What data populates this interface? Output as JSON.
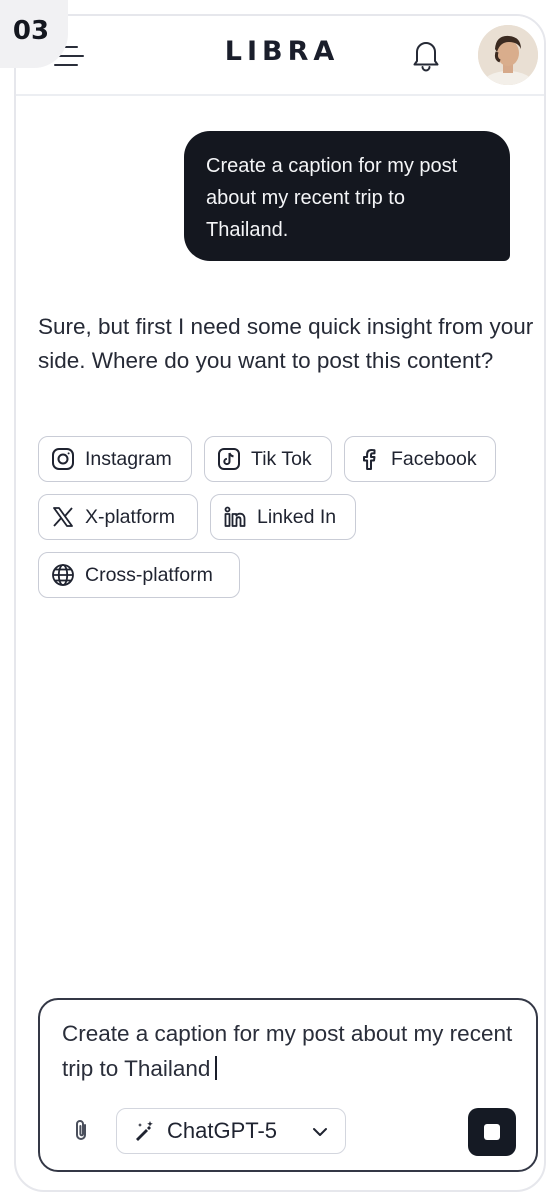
{
  "step_badge": "03",
  "header": {
    "brand": "LIBRA",
    "menu_icon": "hamburger-menu-icon",
    "notification_icon": "bell-icon",
    "avatar": "user-avatar"
  },
  "chat": {
    "user_message": "Create a caption for my post about my recent trip to Thailand.",
    "assistant_message": "Sure, but first I need some quick insight from your side. Where do you want to post this content?",
    "platforms": [
      {
        "label": "Instagram",
        "icon": "instagram-icon"
      },
      {
        "label": "Tik Tok",
        "icon": "tiktok-icon"
      },
      {
        "label": "Facebook",
        "icon": "facebook-icon"
      },
      {
        "label": "X-platform",
        "icon": "x-icon"
      },
      {
        "label": "Linked In",
        "icon": "linkedin-icon"
      },
      {
        "label": "Cross-platform",
        "icon": "globe-icon"
      }
    ]
  },
  "composer": {
    "value": "Create a caption for my post about my recent trip to Thailand",
    "attach_icon": "paperclip-icon",
    "model": "ChatGPT-5",
    "model_icon": "magic-wand-icon",
    "stop_icon": "stop-icon"
  },
  "colors": {
    "dark": "#14171f",
    "border": "#c9ccd6",
    "text": "#262a36"
  }
}
